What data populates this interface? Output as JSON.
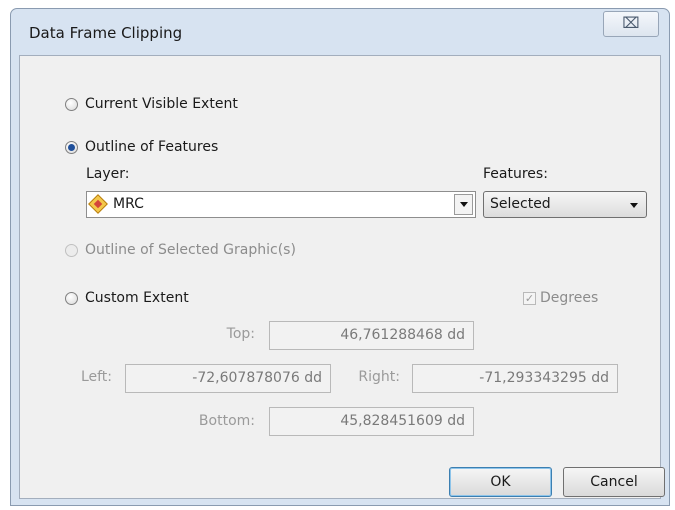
{
  "window": {
    "title": "Data Frame Clipping",
    "close_glyph": "⌧"
  },
  "options": {
    "current_visible_extent": "Current Visible Extent",
    "outline_of_features": "Outline of Features",
    "outline_of_selected_graphics": "Outline of Selected Graphic(s)",
    "custom_extent": "Custom Extent",
    "selected_option": "outline_of_features"
  },
  "layer": {
    "label": "Layer:",
    "value": "MRC",
    "icon": "layer-diamond-icon"
  },
  "features": {
    "label": "Features:",
    "value": "Selected"
  },
  "degrees": {
    "label": "Degrees",
    "checked": true,
    "check_glyph": "✓"
  },
  "extent": {
    "top_label": "Top:",
    "top_value": "46,761288468 dd",
    "left_label": "Left:",
    "left_value": "-72,607878076 dd",
    "right_label": "Right:",
    "right_value": "-71,293343295 dd",
    "bottom_label": "Bottom:",
    "bottom_value": "45,828451609 dd"
  },
  "buttons": {
    "ok": "OK",
    "cancel": "Cancel"
  }
}
